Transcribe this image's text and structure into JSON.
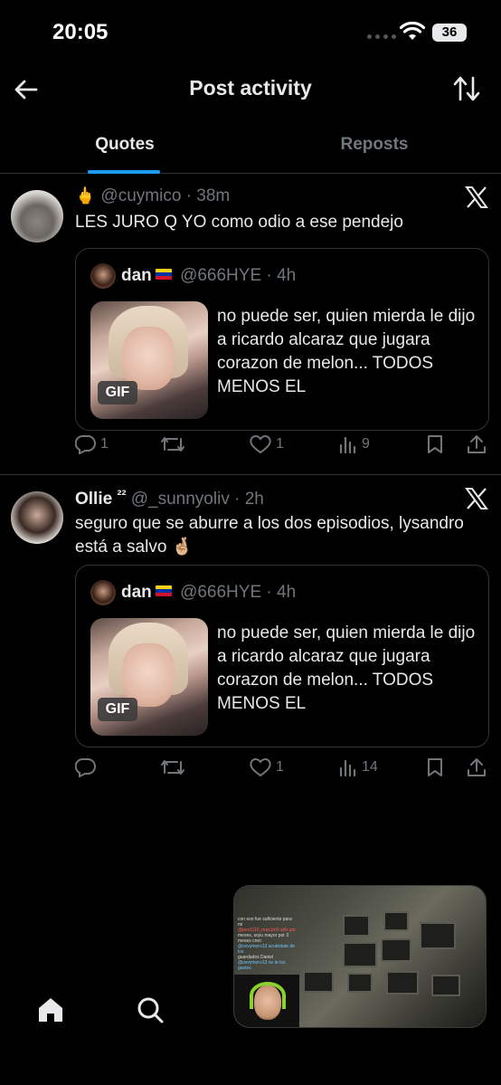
{
  "status_bar": {
    "time": "20:05",
    "battery": "36"
  },
  "header": {
    "title": "Post activity",
    "back_icon": "arrow-left-icon",
    "sort_icon": "sort-arrows-icon"
  },
  "tabs": [
    {
      "label": "Quotes",
      "active": true
    },
    {
      "label": "Reposts",
      "active": false
    }
  ],
  "accent_color": "#1d9bf0",
  "posts": [
    {
      "prefix_emoji": "🖕",
      "name": "",
      "badge": "",
      "handle": "@cuymico",
      "time": "· 38m",
      "text": "LES JURO Q YO como odio a ese pendejo",
      "quote": {
        "name": "dan",
        "handle": "@666HYE",
        "time": "· 4h",
        "gif_label": "GIF",
        "text": "no puede ser, quien mierda le dijo a ricardo alcaraz que jugara corazon de melon... TODOS MENOS EL"
      },
      "actions": {
        "replies": "1",
        "reposts": "",
        "likes": "1",
        "views": "9"
      }
    },
    {
      "prefix_emoji": "",
      "name": "Ollie",
      "badge": "²²",
      "handle": "@_sunnyoliv",
      "time": "· 2h",
      "text": "seguro que se aburre a los dos episodios, lysandro está a salvo 🤞🏼",
      "quote": {
        "name": "dan",
        "handle": "@666HYE",
        "time": "· 4h",
        "gif_label": "GIF",
        "text": "no puede ser, quien mierda le dijo a ricardo alcaraz que jugara corazon de melon... TODOS MENOS EL"
      },
      "actions": {
        "replies": "",
        "reposts": "",
        "likes": "1",
        "views": "14"
      }
    }
  ],
  "pip": {
    "chat": [
      "con eso fue suficiente para mi",
      "@pes1110_max1m0 ahh por",
      "meses, soyu mayor por 3",
      "meses creo",
      "@ovvymoro13 acuérdate de los",
      "guardados Daniel",
      "@ovvymoro13 no te los gastes"
    ]
  },
  "bottom_nav": {
    "home_icon": "home-icon",
    "search_icon": "search-icon"
  }
}
